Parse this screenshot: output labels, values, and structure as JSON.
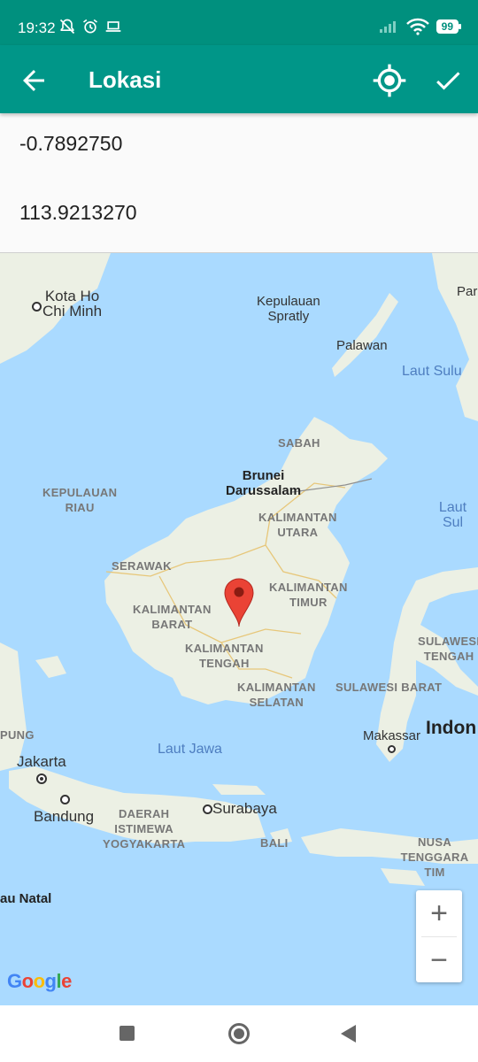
{
  "status_bar": {
    "time": "19:32",
    "battery": "99",
    "icons": [
      "notifications-off-icon",
      "alarm-icon",
      "laptop-icon",
      "signal-icon",
      "wifi-icon",
      "battery-icon"
    ]
  },
  "app_bar": {
    "title": "Lokasi",
    "back_icon": "arrow-back-icon",
    "locate_icon": "my-location-icon",
    "confirm_icon": "check-icon",
    "color": "#009688"
  },
  "form": {
    "latitude": "-0.7892750",
    "longitude": "113.9213270"
  },
  "map": {
    "labels": {
      "kota_ho_chi_minh": "Kota Ho\nChi Minh",
      "kepulauan_spratly": "Kepulauan\nSpratly",
      "palawan": "Palawan",
      "laut_sulu_1": "Laut Sulu",
      "laut_sulu_2": "Laut Sul",
      "par": "Par",
      "sabah": "SABAH",
      "brunei": "Brunei\nDarussalam",
      "kepulauan_riau": "KEPULAUAN\nRIAU",
      "kalimantan_utara": "KALIMANTAN\nUTARA",
      "serawak": "SERAWAK",
      "kalimantan_timur": "KALIMANTAN\nTIMUR",
      "kalimantan_barat": "KALIMANTAN\nBARAT",
      "kalimantan_tengah": "KALIMANTAN\nTENGAH",
      "kalimantan_selatan": "KALIMANTAN\nSELATAN",
      "sulawesi_tengah": "SULAWESI\nTENGAH",
      "sulawesi_barat": "SULAWESI BARAT",
      "pung": "PUNG",
      "jakarta": "Jakarta",
      "laut_jawa": "Laut Jawa",
      "makassar": "Makassar",
      "indon": "Indon",
      "bandung": "Bandung",
      "daerah_istimewa": "DAERAH\nISTIMEWA\nYOGYAKARTA",
      "surabaya": "Surabaya",
      "bali": "BALI",
      "nusa_tenggara": "NUSA\nTENGGARA TIM",
      "au_natal": "au Natal"
    },
    "marker_icon": "map-pin-icon",
    "zoom_in": "+",
    "zoom_out": "−",
    "attribution": "Google"
  },
  "nav_bar": {
    "icons": [
      "recents-icon",
      "home-icon",
      "back-icon"
    ]
  }
}
